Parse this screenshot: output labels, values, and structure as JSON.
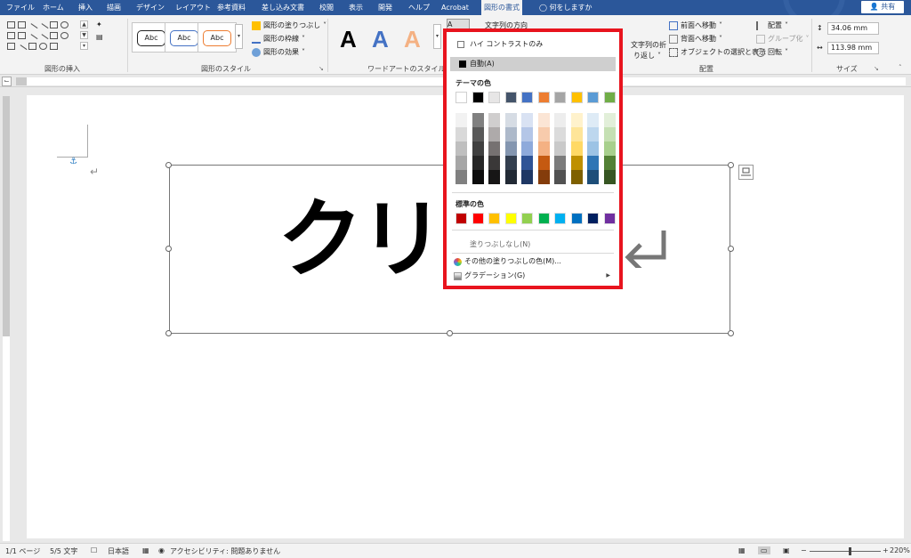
{
  "ribbon": {
    "tabs": [
      "ファイル",
      "ホーム",
      "挿入",
      "描画",
      "デザイン",
      "レイアウト",
      "参考資料",
      "差し込み文書",
      "校閲",
      "表示",
      "開発",
      "ヘルプ",
      "Acrobat",
      "図形の書式"
    ],
    "active_tab": "図形の書式",
    "search_label": "何をしますか",
    "share_label": "共有",
    "groups": {
      "insert_shapes": "図形の挿入",
      "shape_styles": "図形のスタイル",
      "wordart_styles": "ワードアートのスタイル",
      "arrange": "配置",
      "size": "サイズ"
    },
    "shape_style_sample": "Abc",
    "shape_fill": "図形の塗りつぶし",
    "shape_outline": "図形の枠線",
    "shape_effects": "図形の効果",
    "wordart_letter": "A",
    "text_direction": "文字列の方向",
    "text_wrap_line1": "文字列の折",
    "text_wrap_line2": "り返し",
    "bring_forward": "前面へ移動",
    "send_backward": "背面へ移動",
    "selection_pane": "オブジェクトの選択と表示",
    "align": "配置",
    "group": "グループ化",
    "rotate": "回転",
    "height": "34.06 mm",
    "width": "113.98 mm"
  },
  "document": {
    "textbox_text": "クリア",
    "paragraph_mark": "↵"
  },
  "dropdown": {
    "high_contrast": "ハイ コントラストのみ",
    "automatic": "自動(A)",
    "theme_colors_label": "テーマの色",
    "standard_colors_label": "標準の色",
    "no_fill": "塗りつぶしなし(N)",
    "more_colors": "その他の塗りつぶしの色(M)...",
    "gradient": "グラデーション(G)",
    "theme_colors": [
      "#ffffff",
      "#000000",
      "#e7e6e6",
      "#44546a",
      "#4472c4",
      "#ed7d31",
      "#a5a5a5",
      "#ffc000",
      "#5b9bd5",
      "#70ad47"
    ],
    "theme_shades": [
      [
        "#f2f2f2",
        "#d9d9d9",
        "#bfbfbf",
        "#a6a6a6",
        "#808080"
      ],
      [
        "#808080",
        "#595959",
        "#404040",
        "#262626",
        "#0d0d0d"
      ],
      [
        "#d0cece",
        "#aeaaaa",
        "#767171",
        "#3a3838",
        "#171616"
      ],
      [
        "#d6dce4",
        "#adb9ca",
        "#8496b0",
        "#333f4f",
        "#222a35"
      ],
      [
        "#d9e2f3",
        "#b4c6e7",
        "#8eaadb",
        "#2f5496",
        "#1f3864"
      ],
      [
        "#fbe5d5",
        "#f7cbac",
        "#f4b183",
        "#c55a11",
        "#843c0b"
      ],
      [
        "#ededed",
        "#dbdbdb",
        "#c9c9c9",
        "#7b7b7b",
        "#525252"
      ],
      [
        "#fff2cc",
        "#fee599",
        "#ffd965",
        "#bf9000",
        "#7f6000"
      ],
      [
        "#deebf6",
        "#bdd7ee",
        "#9cc3e5",
        "#2e75b5",
        "#1e4e79"
      ],
      [
        "#e2efd9",
        "#c5e0b3",
        "#a8d08d",
        "#538135",
        "#375623"
      ]
    ],
    "standard_colors": [
      "#c00000",
      "#ff0000",
      "#ffc000",
      "#ffff00",
      "#92d050",
      "#00b050",
      "#00b0f0",
      "#0070c0",
      "#002060",
      "#7030a0"
    ]
  },
  "status_bar": {
    "page": "1/1 ページ",
    "words": "5/5 文字",
    "language": "日本語",
    "accessibility": "アクセシビリティ: 問題ありません",
    "zoom": "220%",
    "zoom_minus": "−",
    "zoom_plus": "+"
  },
  "colors": {
    "ribbon_blue": "#2b579a",
    "highlight_red": "#e8141e"
  }
}
